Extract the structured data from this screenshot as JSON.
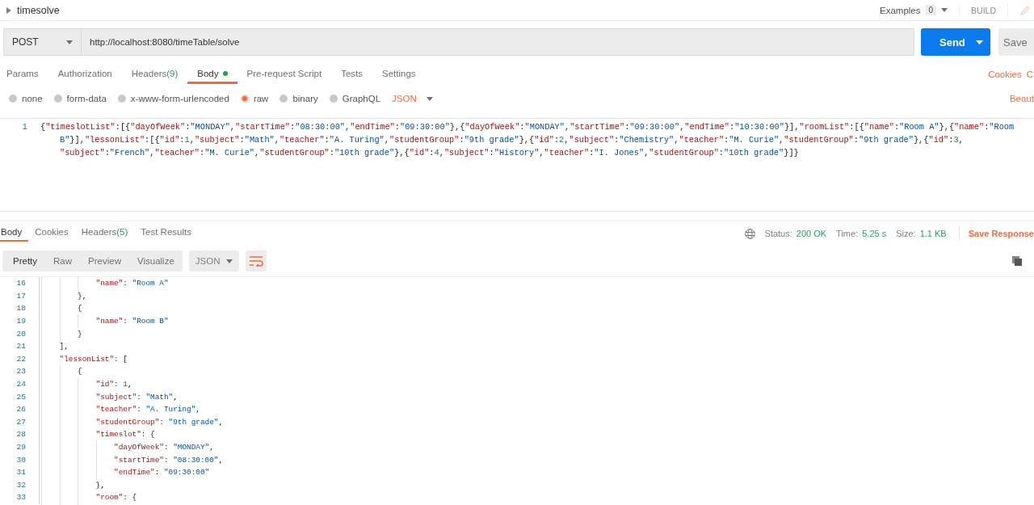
{
  "request": {
    "name": "timesolve",
    "examples_label": "Examples",
    "examples_count": "0",
    "build_label": "BUILD",
    "method": "POST",
    "url": "http://localhost:8080/timeTable/solve",
    "send_label": "Send",
    "save_label": "Save"
  },
  "request_tabs": [
    {
      "label": "Params",
      "selected": false
    },
    {
      "label": "Authorization",
      "selected": false
    },
    {
      "label": "Headers",
      "count": "(9)",
      "selected": false
    },
    {
      "label": "Body",
      "selected": true,
      "has_content": true
    },
    {
      "label": "Pre-request Script",
      "selected": false
    },
    {
      "label": "Tests",
      "selected": false
    },
    {
      "label": "Settings",
      "selected": false
    }
  ],
  "request_links": [
    "Cookies",
    "C"
  ],
  "body_types": [
    {
      "label": "none",
      "selected": false
    },
    {
      "label": "form-data",
      "selected": false
    },
    {
      "label": "x-www-form-urlencoded",
      "selected": false
    },
    {
      "label": "raw",
      "selected": true
    },
    {
      "label": "binary",
      "selected": false
    },
    {
      "label": "GraphQL",
      "selected": false
    }
  ],
  "body_format": "JSON",
  "beautify_label": "Beaut",
  "request_body": {
    "lines": [
      {
        "number": "1",
        "text": "{\"timeslotList\":[{\"dayOfWeek\":\"MONDAY\",\"startTime\":\"08:30:00\",\"endTime\":\"09:30:00\"},{\"dayOfWeek\":\"MONDAY\",\"startTime\":\"09:30:00\",\"endTime\":\"10:30:00\"}],\"roomList\":[{\"name\":\"Room A\"},{\"name\":\"Room B\"}],\"lessonList\":[{\"id\":1,\"subject\":\"Math\",\"teacher\":\"A. Turing\",\"studentGroup\":\"9th grade\"},{\"id\":2,\"subject\":\"Chemistry\",\"teacher\":\"M. Curie\",\"studentGroup\":\"9th grade\"},{\"id\":3,\"subject\":\"French\",\"teacher\":\"M. Curie\",\"studentGroup\":\"10th grade\"},{\"id\":4,\"subject\":\"History\",\"teacher\":\"I. Jones\",\"studentGroup\":\"10th grade\"}]}"
      }
    ]
  },
  "response_tabs": [
    {
      "label": "Body",
      "selected": true
    },
    {
      "label": "Cookies",
      "selected": false
    },
    {
      "label": "Headers",
      "count": "(5)",
      "selected": false
    },
    {
      "label": "Test Results",
      "selected": false
    }
  ],
  "response_meta": {
    "status_label": "Status:",
    "status": "200 OK",
    "time_label": "Time:",
    "time": "5.25 s",
    "size_label": "Size:",
    "size": "1.1 KB",
    "save_label": "Save Response"
  },
  "view_modes": [
    {
      "label": "Pretty",
      "selected": true
    },
    {
      "label": "Raw",
      "selected": false
    },
    {
      "label": "Preview",
      "selected": false
    },
    {
      "label": "Visualize",
      "selected": false
    }
  ],
  "response_format": "JSON",
  "response_body": {
    "lines": [
      {
        "number": "16",
        "text": "            \"name\": \"Room A\""
      },
      {
        "number": "17",
        "text": "        },"
      },
      {
        "number": "18",
        "text": "        {"
      },
      {
        "number": "19",
        "text": "            \"name\": \"Room B\""
      },
      {
        "number": "20",
        "text": "        }"
      },
      {
        "number": "21",
        "text": "    ],"
      },
      {
        "number": "22",
        "text": "    \"lessonList\": ["
      },
      {
        "number": "23",
        "text": "        {"
      },
      {
        "number": "24",
        "text": "            \"id\": 1,"
      },
      {
        "number": "25",
        "text": "            \"subject\": \"Math\","
      },
      {
        "number": "26",
        "text": "            \"teacher\": \"A. Turing\","
      },
      {
        "number": "27",
        "text": "            \"studentGroup\": \"9th grade\","
      },
      {
        "number": "28",
        "text": "            \"timeslot\": {"
      },
      {
        "number": "29",
        "text": "                \"dayOfWeek\": \"MONDAY\","
      },
      {
        "number": "30",
        "text": "                \"startTime\": \"08:30:00\","
      },
      {
        "number": "31",
        "text": "                \"endTime\": \"09:30:00\""
      },
      {
        "number": "32",
        "text": "            },"
      },
      {
        "number": "33",
        "text": "            \"room\": {"
      }
    ]
  }
}
